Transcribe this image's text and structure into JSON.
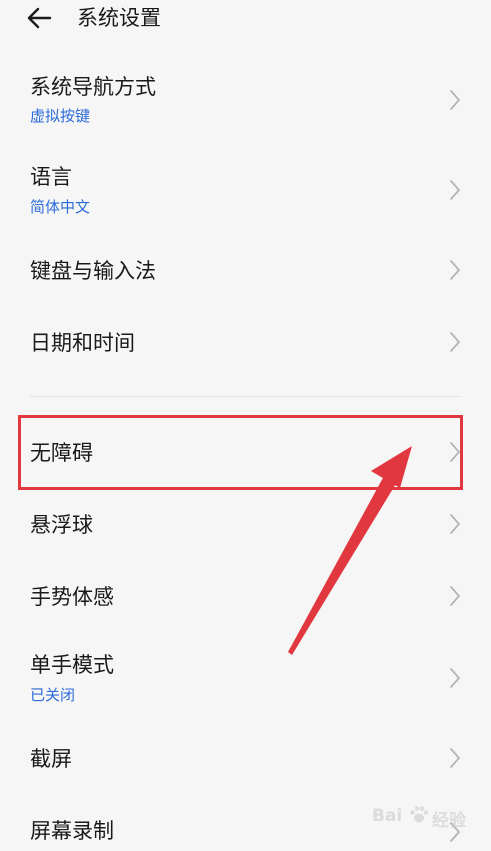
{
  "header": {
    "title": "系统设置",
    "back_icon": "arrow-left-icon"
  },
  "items": [
    {
      "title": "系统导航方式",
      "subtitle": "虚拟按键"
    },
    {
      "title": "语言",
      "subtitle": "简体中文"
    },
    {
      "title": "键盘与输入法"
    },
    {
      "title": "日期和时间"
    },
    {
      "title": "无障碍"
    },
    {
      "title": "悬浮球"
    },
    {
      "title": "手势体感"
    },
    {
      "title": "单手模式",
      "subtitle": "已关闭"
    },
    {
      "title": "截屏"
    },
    {
      "title": "屏幕录制"
    }
  ],
  "colors": {
    "background": "#f6f6f6",
    "subtitle": "#2d6bd9",
    "annotation": "#e0383e",
    "chevron": "#b5b5b5"
  },
  "watermark": {
    "logo": "Bai",
    "logo_icon": "paw-icon",
    "logo_suffix": "经验"
  }
}
